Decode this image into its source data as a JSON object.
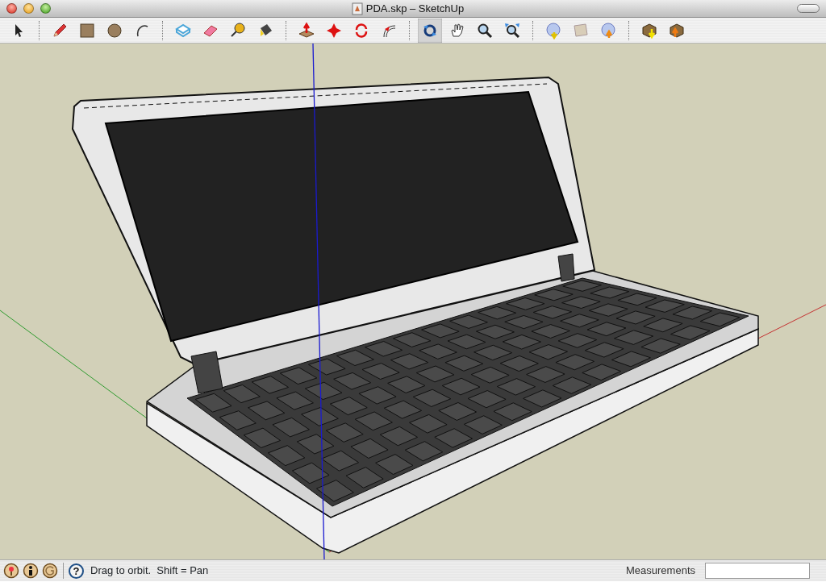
{
  "window": {
    "title": "PDA.skp – SketchUp"
  },
  "toolbar": {
    "groups": [
      [
        {
          "selected": false
        }
      ],
      [
        {
          "selected": false
        },
        {
          "selected": false
        },
        {
          "selected": false
        },
        {
          "selected": false
        }
      ],
      [
        {
          "selected": false
        },
        {
          "selected": false
        },
        {
          "selected": false
        },
        {
          "selected": false
        }
      ],
      [
        {
          "selected": false
        },
        {
          "selected": false
        },
        {
          "selected": false
        },
        {
          "selected": false
        }
      ],
      [
        {
          "selected": true
        },
        {
          "selected": false
        },
        {
          "selected": false
        },
        {
          "selected": false
        }
      ],
      [
        {
          "selected": false
        },
        {
          "selected": false
        },
        {
          "selected": false
        }
      ],
      [
        {
          "selected": false
        },
        {
          "selected": false
        }
      ]
    ]
  },
  "status_bar": {
    "help": "?",
    "hint": "Drag to orbit.  Shift = Pan",
    "measurements_label": "Measurements"
  }
}
